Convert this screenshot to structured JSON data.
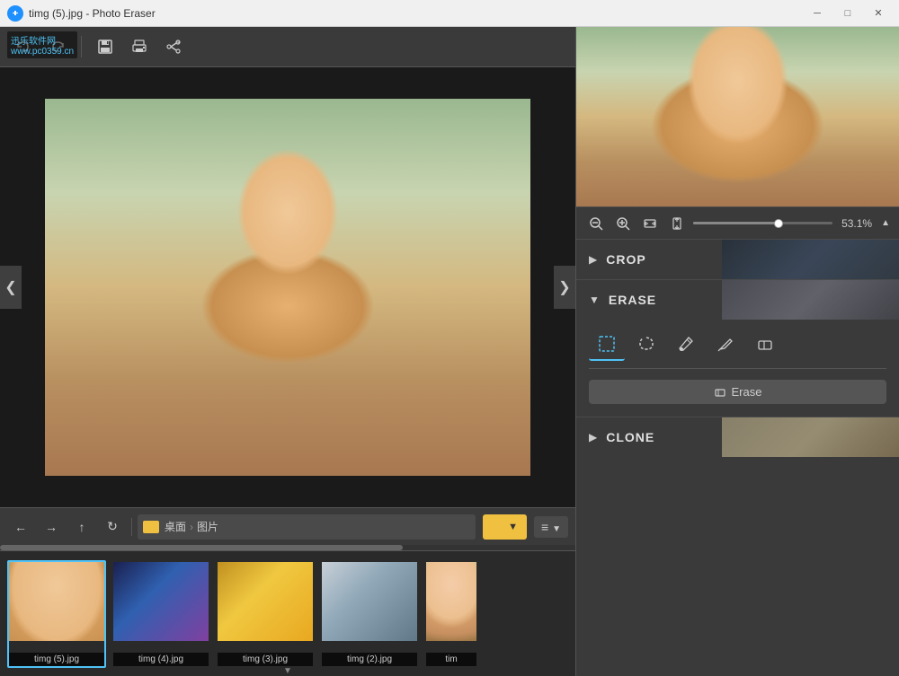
{
  "window": {
    "title": "timg (5).jpg - Photo Eraser",
    "icon": "photo-eraser-icon"
  },
  "titlebar": {
    "minimize_label": "─",
    "maximize_label": "□",
    "close_label": "✕"
  },
  "watermark": {
    "line1": "迅乐软件网",
    "line2": "www.pc0359.cn"
  },
  "toolbar": {
    "undo_label": "↺",
    "redo_label": "↻",
    "save_label": "💾",
    "print_label": "🖨",
    "share_label": "↗"
  },
  "zoom": {
    "zoom_in_label": "🔍",
    "zoom_out_label": "🔍",
    "value": "53.1%",
    "slider_pct": 60
  },
  "right_panel": {
    "sections": [
      {
        "id": "crop",
        "title": "CROP",
        "expanded": false,
        "arrow": "▶"
      },
      {
        "id": "erase",
        "title": "ERASE",
        "expanded": true,
        "arrow": "▼"
      },
      {
        "id": "clone",
        "title": "CLONE",
        "expanded": false,
        "arrow": "▶"
      }
    ],
    "erase": {
      "tools": [
        {
          "id": "rect",
          "icon": "⬜",
          "label": "Rectangle Select",
          "active": true
        },
        {
          "id": "lasso",
          "icon": "⭕",
          "label": "Lasso Select",
          "active": false
        },
        {
          "id": "brush",
          "icon": "🖌",
          "label": "Brush",
          "active": false
        },
        {
          "id": "pen",
          "icon": "✏",
          "label": "Pen",
          "active": false
        },
        {
          "id": "eraser",
          "icon": "◻",
          "label": "Eraser",
          "active": false
        }
      ],
      "action_button": "Erase",
      "action_icon": "◇"
    }
  },
  "nav_bar": {
    "back": "←",
    "forward": "→",
    "up": "↑",
    "refresh": "↺",
    "folder_icon": "📁",
    "desktop": "桌面",
    "sep": "›",
    "pictures": "图片",
    "star_label": "★",
    "filter_label": "≡"
  },
  "filmstrip": {
    "items": [
      {
        "id": 1,
        "name": "timg (5).jpg",
        "active": true
      },
      {
        "id": 2,
        "name": "timg (4).jpg",
        "active": false
      },
      {
        "id": 3,
        "name": "timg (3).jpg",
        "active": false
      },
      {
        "id": 4,
        "name": "timg (2).jpg",
        "active": false
      },
      {
        "id": 5,
        "name": "tim",
        "active": false
      }
    ]
  },
  "colors": {
    "accent": "#4fc3f7",
    "active_border": "#4fc3f7",
    "star_color": "#f0c040",
    "bg_dark": "#2b2b2b",
    "bg_panel": "#3a3a3a"
  }
}
